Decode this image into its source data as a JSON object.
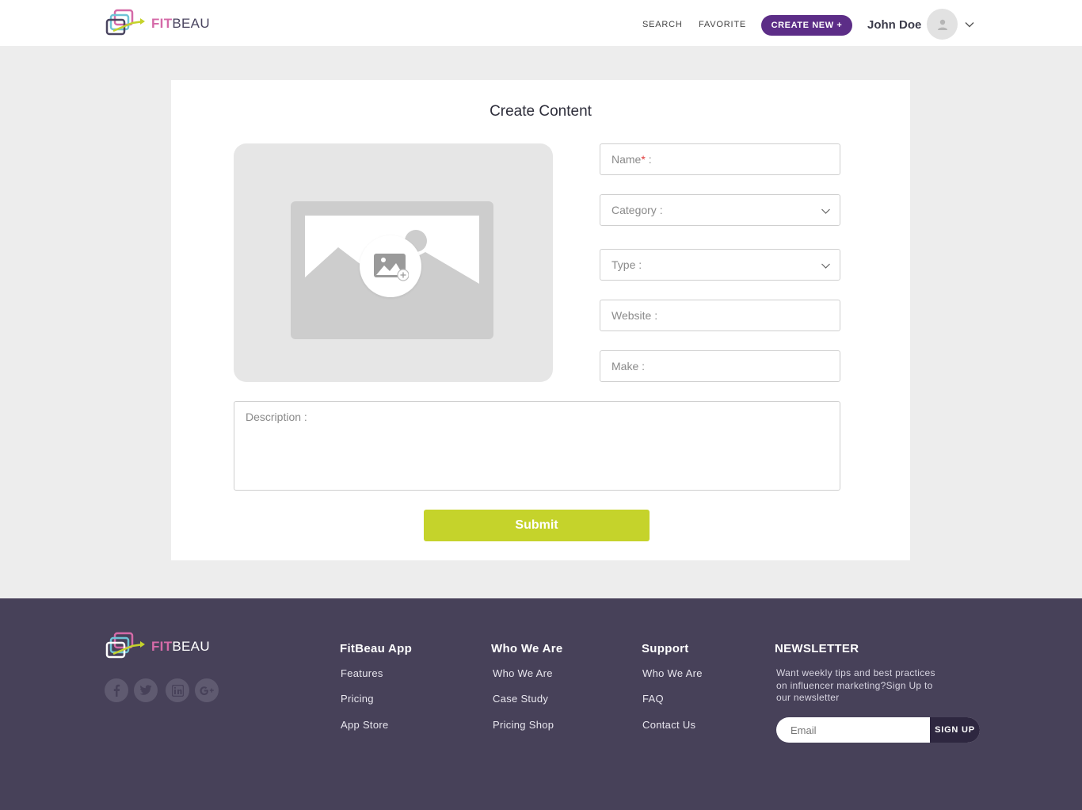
{
  "header": {
    "brand_fit": "FIT",
    "brand_beau": "BEAU",
    "nav": {
      "search": "SEARCH",
      "favorite": "FAVORITE"
    },
    "create_new": "CREATE NEW +",
    "user_name": "John Doe"
  },
  "form": {
    "title": "Create Content",
    "name_label": "Name",
    "name_required": "*",
    "name_suffix": " :",
    "category": "Category :",
    "type": "Type :",
    "website": "Website :",
    "make": "Make :",
    "description": "Description :",
    "submit": "Submit"
  },
  "footer": {
    "brand_fit": "FIT",
    "brand_beau": "BEAU",
    "social": [
      "facebook-icon",
      "twitter-icon",
      "linkedin-icon",
      "google-plus-icon"
    ],
    "columns": [
      {
        "heading": "FitBeau App",
        "links": [
          "Features",
          "Pricing",
          "App Store"
        ]
      },
      {
        "heading": "Who We Are",
        "links": [
          "Who We Are",
          "Case Study",
          "Pricing Shop"
        ]
      },
      {
        "heading": "Support",
        "links": [
          "Who We Are",
          "FAQ",
          "Contact Us"
        ]
      }
    ],
    "newsletter": {
      "heading": "NEWSLETTER",
      "text": "Want weekly tips and best practices on influencer marketing?Sign Up to our newsletter",
      "placeholder": "Email",
      "button": "SIGN UP"
    }
  },
  "colors": {
    "accent_purple": "#5c2d87",
    "submit_green": "#c5d32b",
    "footer_bg": "#474159",
    "brand_pink": "#d56aa8"
  }
}
